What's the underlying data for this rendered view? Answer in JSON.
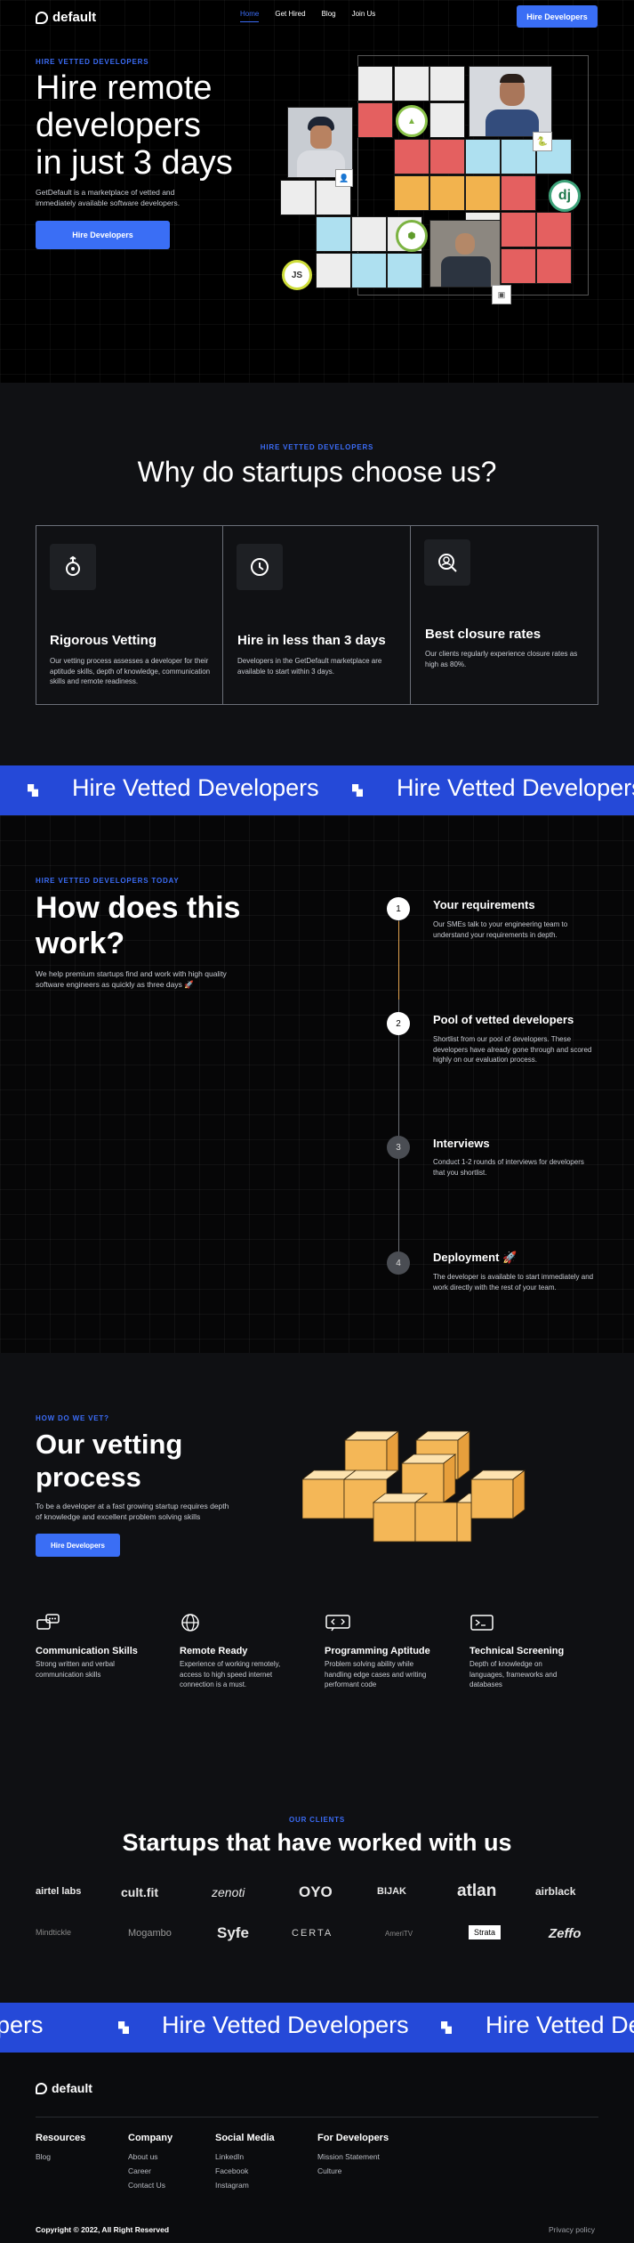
{
  "nav": {
    "brand": "default",
    "links": [
      "Home",
      "Get Hired",
      "Blog",
      "Join Us"
    ],
    "cta": "Hire Developers"
  },
  "hero": {
    "eyebrow": "HIRE VETTED DEVELOPERS",
    "title_lines": [
      "Hire remote",
      "developers",
      "in just 3 days"
    ],
    "subtitle": "GetDefault is a marketplace of vetted and immediately available software developers.",
    "cta": "Hire Developers"
  },
  "why": {
    "eyebrow": "HIRE VETTED DEVELOPERS",
    "title": "Why do startups choose us?",
    "cards": [
      {
        "icon": "medal-icon",
        "title": "Rigorous Vetting",
        "text": "Our vetting process assesses a developer for their aptitude skills, depth of knowledge, communication skills and remote readiness."
      },
      {
        "icon": "clock-icon",
        "title": "Hire in less than 3 days",
        "text": "Developers in the GetDefault marketplace are available to start within 3 days."
      },
      {
        "icon": "user-search-icon",
        "title": "Best closure rates",
        "text": "Our clients regularly experience closure rates as high as 80%."
      }
    ]
  },
  "ticker": {
    "text": "Hire Vetted Developers"
  },
  "how": {
    "eyebrow": "HIRE VETTED DEVELOPERS TODAY",
    "title_lines": [
      "How does this",
      "work?"
    ],
    "subtitle": "We help premium startups find and work with high quality software engineers as quickly as three days 🚀",
    "steps": [
      {
        "num": "1",
        "title": "Your requirements",
        "text": "Our SMEs talk to your engineering team to understand your requirements in depth."
      },
      {
        "num": "2",
        "title": "Pool of vetted developers",
        "text": "Shortlist from our pool of developers. These developers have already gone through and scored highly on our evaluation process."
      },
      {
        "num": "3",
        "title": "Interviews",
        "text": "Conduct 1-2 rounds of interviews for developers that you shortlist."
      },
      {
        "num": "4",
        "title": "Deployment 🚀",
        "text": "The developer is available to start immediately and work directly with the rest of your team."
      }
    ]
  },
  "vetting": {
    "eyebrow": "HOW DO WE VET?",
    "title_lines": [
      "Our vetting",
      "process"
    ],
    "subtitle": "To be a developer at a fast growing startup requires depth of knowledge and excellent problem solving skills",
    "cta": "Hire Developers",
    "features": [
      {
        "icon": "chat-icon",
        "title": "Communication Skills",
        "text": "Strong written and verbal communication skills"
      },
      {
        "icon": "globe-icon",
        "title": "Remote Ready",
        "text": "Experience of working remotely, access to high speed internet connection is a must."
      },
      {
        "icon": "code-chat-icon",
        "title": "Programming Aptitude",
        "text": "Problem solving ability while handling edge cases and writing performant code"
      },
      {
        "icon": "terminal-icon",
        "title": "Technical Screening",
        "text": "Depth of knowledge on languages, frameworks and databases"
      }
    ]
  },
  "clients": {
    "eyebrow": "OUR CLIENTS",
    "title": "Startups that have worked with us",
    "row1": [
      "airtel labs",
      "cult.fit",
      "zenoti",
      "OYO",
      "BIJAK",
      "atlan",
      "airblack"
    ],
    "row2": [
      "Mindtickle",
      "Mogambo",
      "Syfe",
      "CERTA",
      "AmeriTV",
      "Strata",
      "Zeffo"
    ]
  },
  "footer": {
    "brand": "default",
    "columns": [
      {
        "title": "Resources",
        "items": [
          "Blog"
        ]
      },
      {
        "title": "Company",
        "items": [
          "About us",
          "Career",
          "Contact Us"
        ]
      },
      {
        "title": "Social Media",
        "items": [
          "LinkedIn",
          "Facebook",
          "Instagram"
        ]
      },
      {
        "title": "For Developers",
        "items": [
          "Mission Statement",
          "Culture"
        ]
      }
    ],
    "copyright": "Copyright © 2022, All Right Reserved",
    "privacy": "Privacy policy"
  },
  "colors": {
    "accent": "#3a6ef5",
    "ticker": "#2549d8",
    "background": "#0b0c0e"
  }
}
